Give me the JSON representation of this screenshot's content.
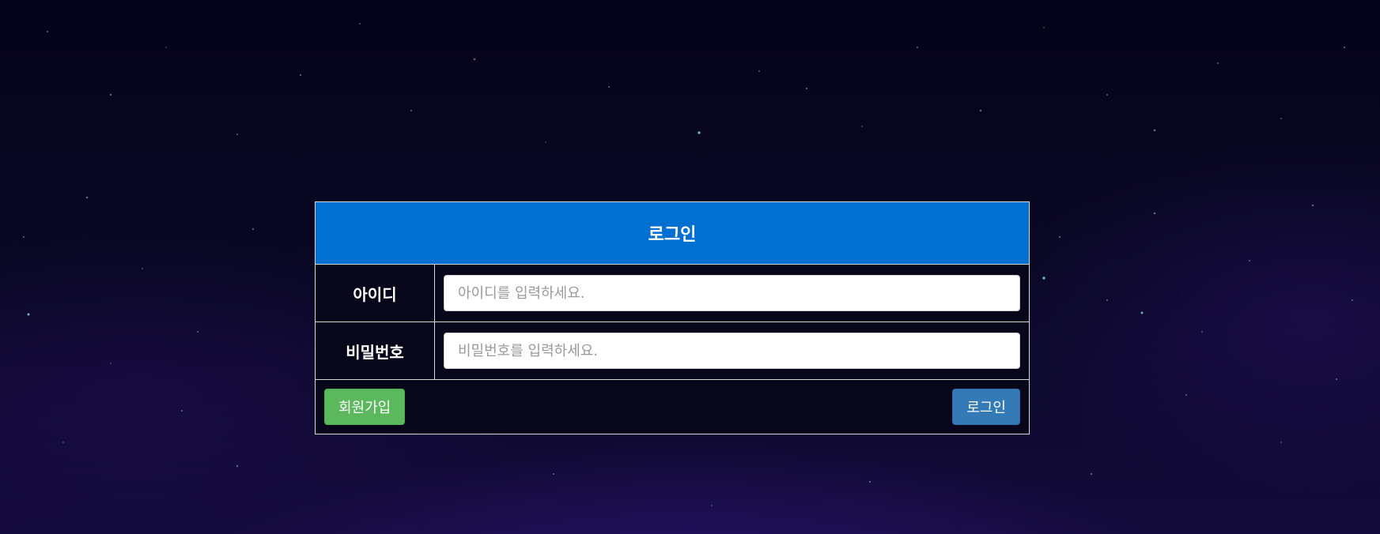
{
  "login": {
    "title": "로그인",
    "id_label": "아이디",
    "id_placeholder": "아이디를 입력하세요.",
    "id_value": "",
    "password_label": "비밀번호",
    "password_placeholder": "비밀번호를 입력하세요.",
    "password_value": "",
    "signup_button": "회원가입",
    "login_button": "로그인"
  },
  "colors": {
    "header": "#0270d1",
    "signup": "#5cb85c",
    "login": "#337ab7",
    "background": "#0a0724"
  }
}
